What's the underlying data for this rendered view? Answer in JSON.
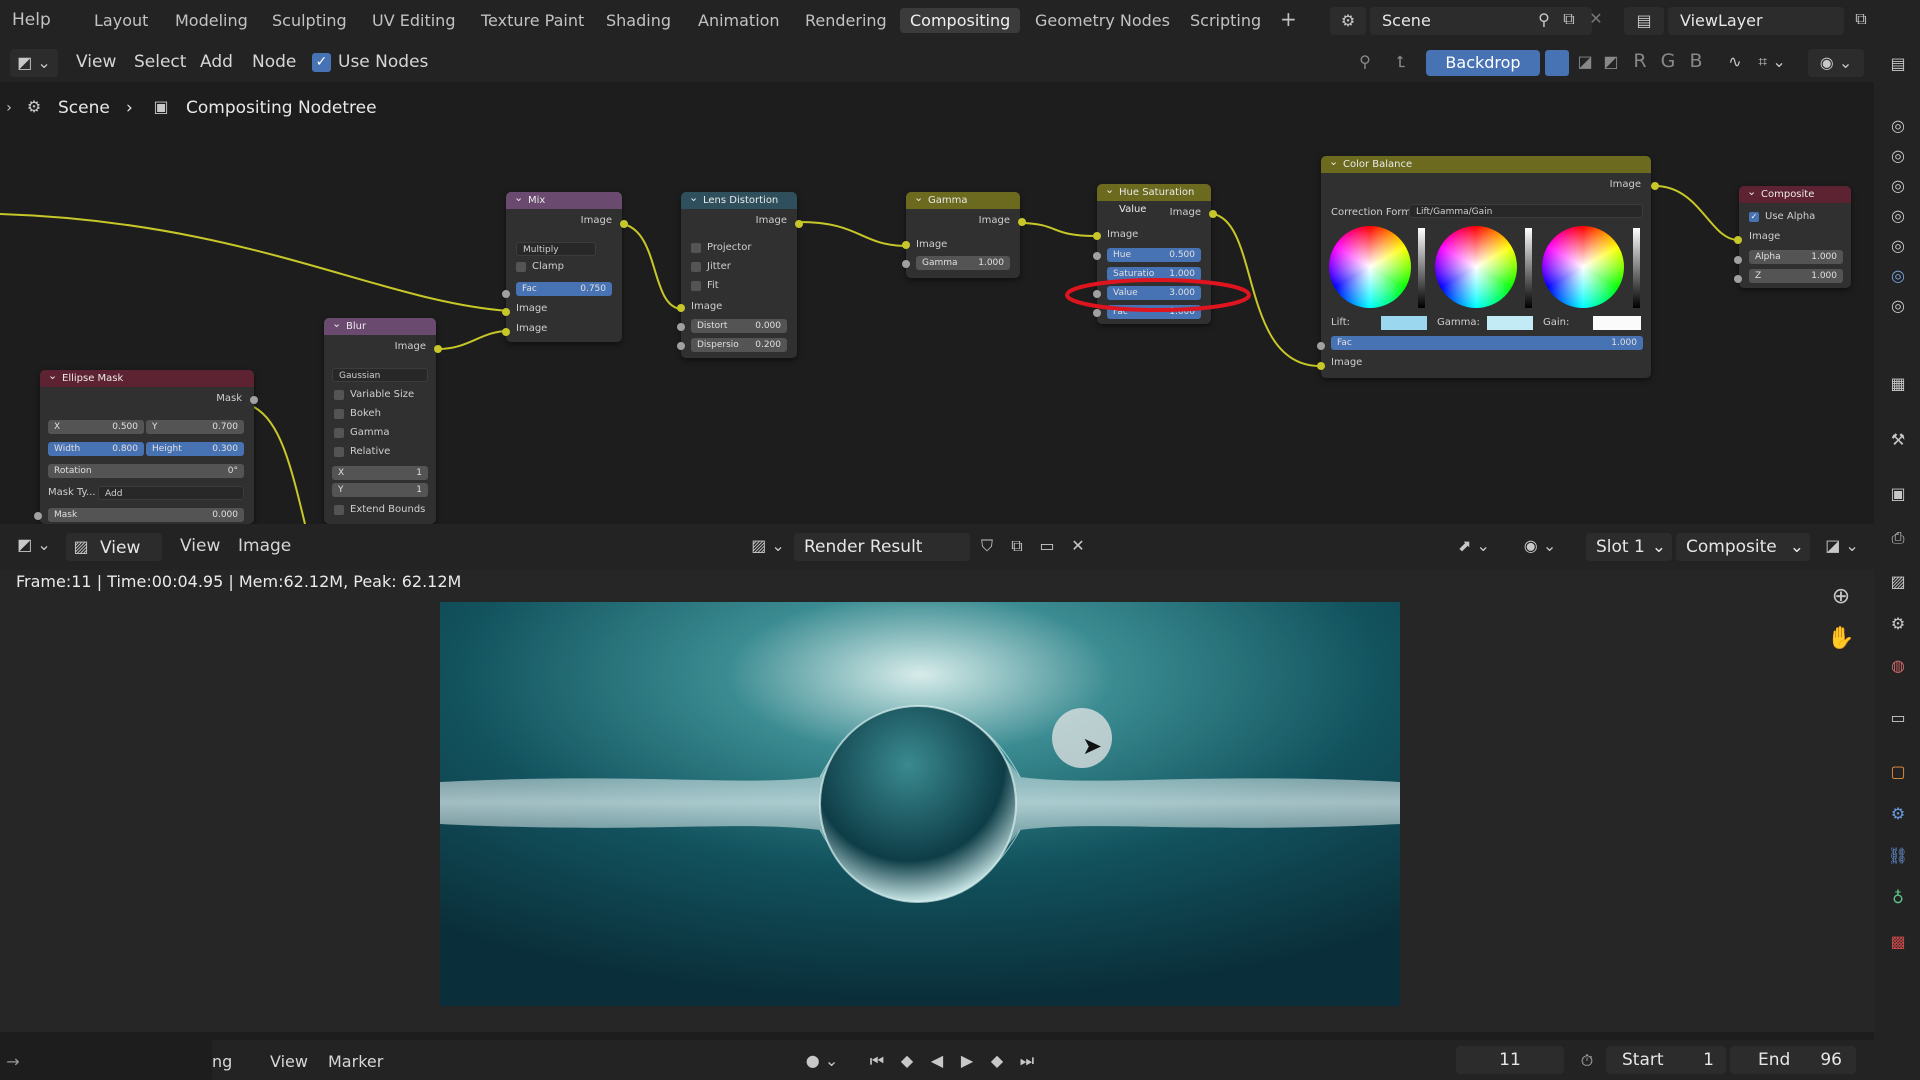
{
  "topbar": {
    "help": "Help",
    "workspaces": [
      "Layout",
      "Modeling",
      "Sculpting",
      "UV Editing",
      "Texture Paint",
      "Shading",
      "Animation",
      "Rendering",
      "Compositing",
      "Geometry Nodes",
      "Scripting"
    ],
    "active_workspace": "Compositing",
    "add_symbol": "+",
    "scene": "Scene",
    "view_layer": "ViewLayer"
  },
  "node_header": {
    "menus": [
      "View",
      "Select",
      "Add",
      "Node"
    ],
    "use_nodes": "Use Nodes",
    "backdrop": "Backdrop",
    "channels": [
      "R",
      "G",
      "B"
    ]
  },
  "breadcrumb": {
    "scene": "Scene",
    "sep": "›",
    "tree": "Compositing Nodetree"
  },
  "nodes": {
    "mix": {
      "title": "Mix",
      "out": "Image",
      "blend": "Multiply",
      "clamp": "Clamp",
      "fac_label": "Fac",
      "fac_value": "0.750",
      "in1": "Image",
      "in2": "Image"
    },
    "lens": {
      "title": "Lens Distortion",
      "out": "Image",
      "projector": "Projector",
      "jitter": "Jitter",
      "fit": "Fit",
      "in": "Image",
      "distort_label": "Distort",
      "distort_value": "0.000",
      "dispersion_label": "Dispersio",
      "dispersion_value": "0.200"
    },
    "gamma": {
      "title": "Gamma",
      "out": "Image",
      "in": "Image",
      "gamma_label": "Gamma",
      "gamma_value": "1.000"
    },
    "hsv": {
      "title": "Hue Saturation Value",
      "out": "Image",
      "in": "Image",
      "hue_label": "Hue",
      "hue_value": "0.500",
      "sat_label": "Saturatio",
      "sat_value": "1.000",
      "val_label": "Value",
      "val_value": "3.000",
      "fac_label": "Fac",
      "fac_value": "1.000"
    },
    "colorbalance": {
      "title": "Color Balance",
      "out": "Image",
      "corr_label": "Correction Form...",
      "corr_value": "Lift/Gamma/Gain",
      "lift": "Lift:",
      "gamma": "Gamma:",
      "gain": "Gain:",
      "fac_label": "Fac",
      "fac_value": "1.000",
      "in": "Image"
    },
    "composite": {
      "title": "Composite",
      "use_alpha": "Use Alpha",
      "in": "Image",
      "alpha_label": "Alpha",
      "alpha_value": "1.000",
      "z_label": "Z",
      "z_value": "1.000"
    },
    "blur": {
      "title": "Blur",
      "out": "Image",
      "filter": "Gaussian",
      "variable_size": "Variable Size",
      "bokeh": "Bokeh",
      "gamma": "Gamma",
      "relative": "Relative",
      "x_label": "X",
      "x_value": "1",
      "y_label": "Y",
      "y_value": "1",
      "extend": "Extend Bounds"
    },
    "ellipse": {
      "title": "Ellipse Mask",
      "out": "Mask",
      "x_label": "X",
      "x_value": "0.500",
      "y_label": "Y",
      "y_value": "0.700",
      "w_label": "Width",
      "w_value": "0.800",
      "h_label": "Height",
      "h_value": "0.300",
      "rot_label": "Rotation",
      "rot_value": "0°",
      "masktype_label": "Mask Ty...",
      "masktype_value": "Add",
      "mask_label": "Mask",
      "mask_value": "0.000"
    }
  },
  "image_header": {
    "menus": [
      "View",
      "View",
      "Image"
    ],
    "image_name": "Render Result",
    "slot": "Slot 1",
    "layer": "Composite"
  },
  "status": "Frame:11 | Time:00:04.95 | Mem:62.12M, Peak: 62.12M",
  "timeline": {
    "partial_menu": "ng",
    "menus": [
      "View",
      "Marker"
    ],
    "current_frame": "11",
    "start_label": "Start",
    "start_value": "1",
    "end_label": "End",
    "end_value": "96"
  },
  "colors": {
    "header_bg": "#232323",
    "active_blue": "#4772b3",
    "annotation_red": "#e0141e",
    "link_yellow": "#c7c729",
    "colorbalance_header": "#6b6a1e",
    "composite_header": "#5e2333"
  }
}
